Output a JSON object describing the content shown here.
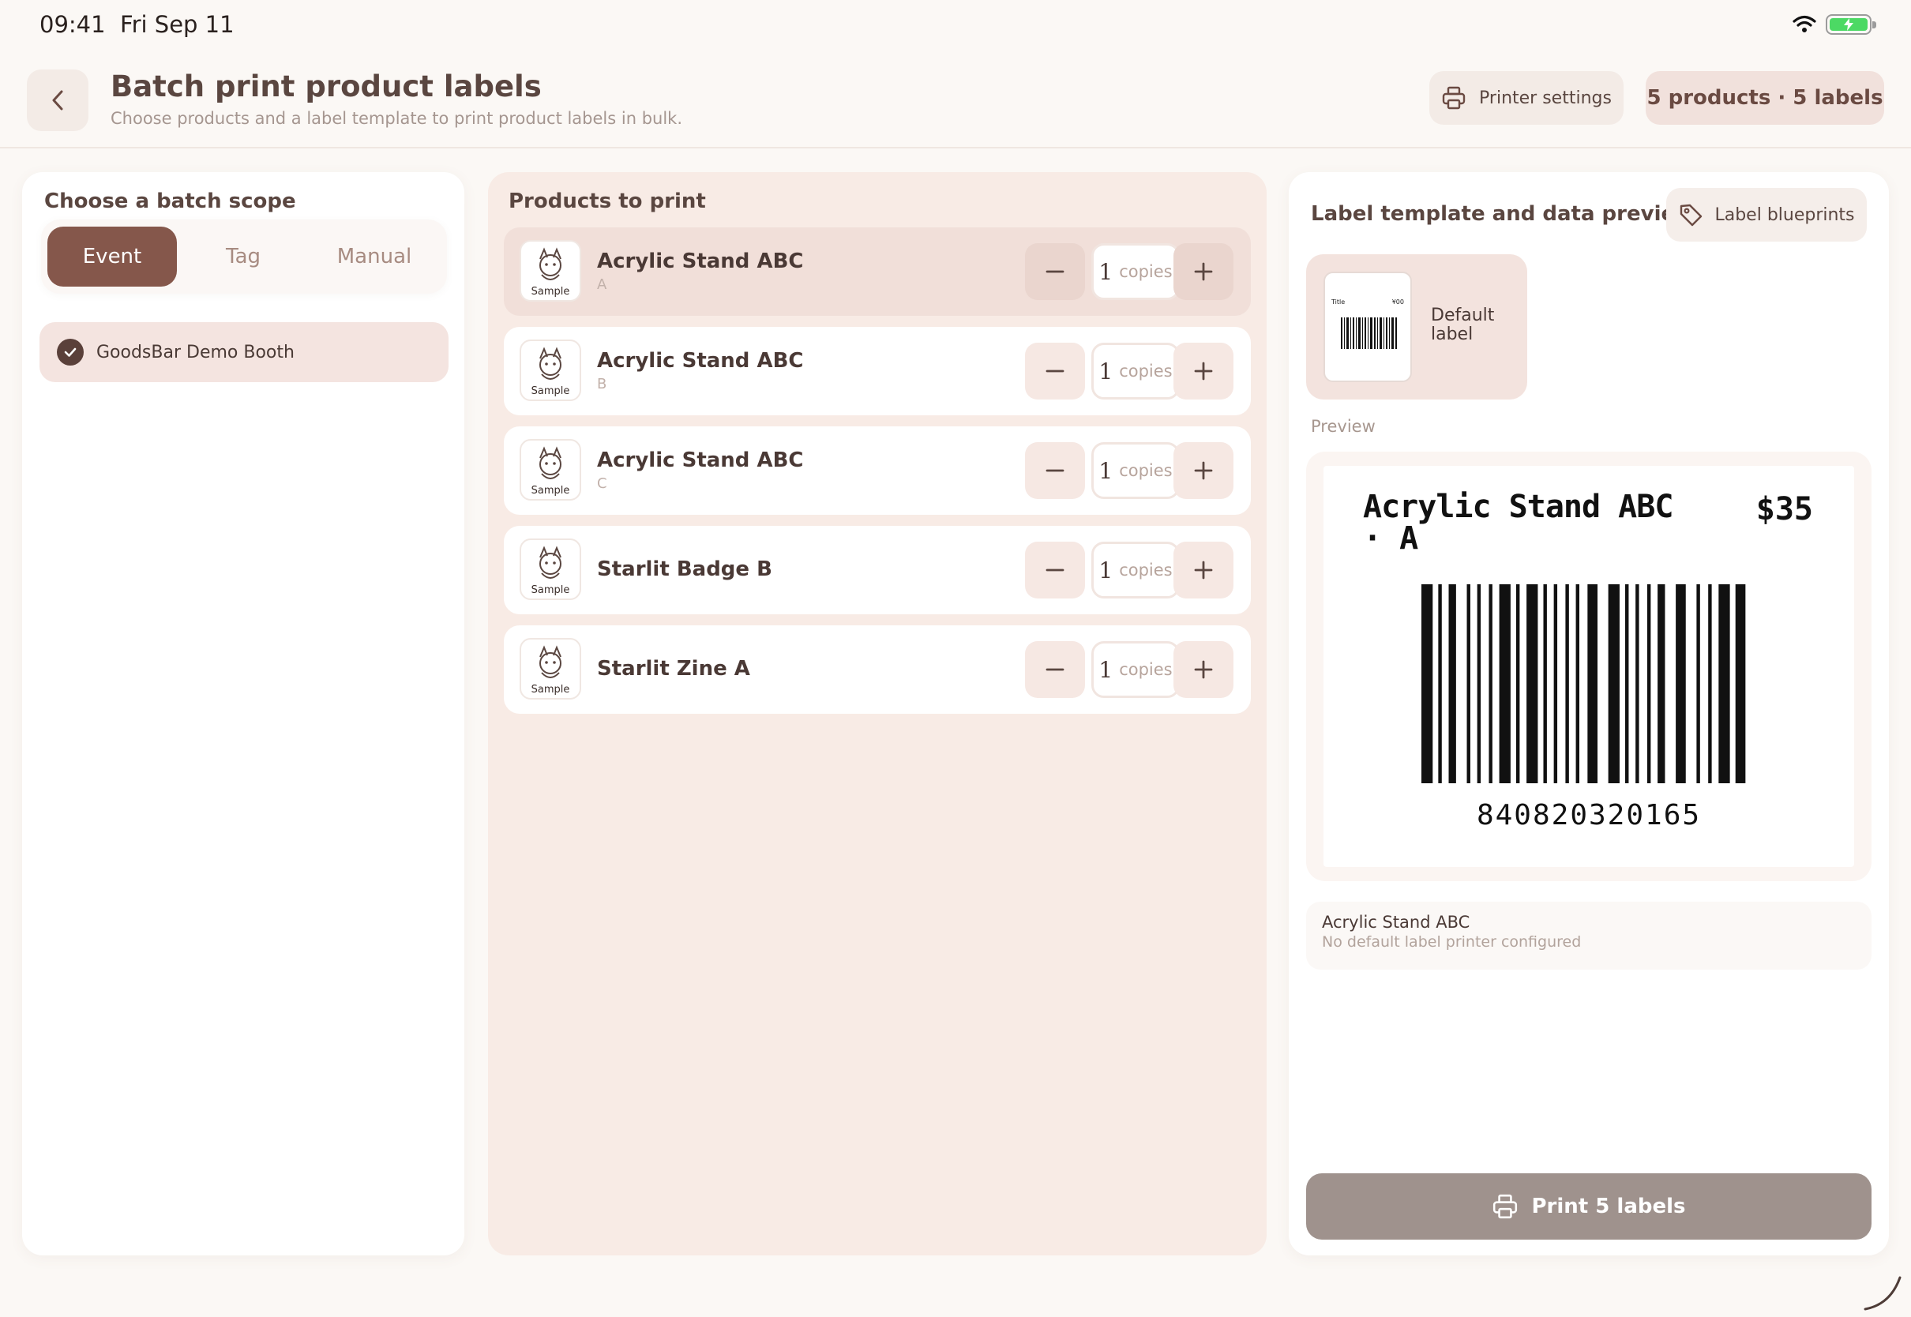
{
  "status_bar": {
    "time": "09:41",
    "date": "Fri Sep 11",
    "wifi_icon": "wifi-icon",
    "battery_icon": "battery-charging-icon"
  },
  "header": {
    "title": "Batch print product labels",
    "subtitle": "Choose products and a label template to print product labels in bulk.",
    "printer_settings_label": "Printer settings",
    "summary": "5 products · 5 labels"
  },
  "scope": {
    "title": "Choose a batch scope",
    "tabs": [
      {
        "label": "Event"
      },
      {
        "label": "Tag"
      },
      {
        "label": "Manual"
      }
    ],
    "selected_tab": "Event",
    "items": [
      {
        "label": "GoodsBar Demo Booth",
        "checked": true
      }
    ]
  },
  "products": {
    "title": "Products to print",
    "thumb_text": "Sample",
    "unit": "copies",
    "rows": [
      {
        "name": "Acrylic Stand ABC",
        "variant": "A",
        "qty": "1"
      },
      {
        "name": "Acrylic Stand ABC",
        "variant": "B",
        "qty": "1"
      },
      {
        "name": "Acrylic Stand ABC",
        "variant": "C",
        "qty": "1"
      },
      {
        "name": "Starlit Badge B",
        "variant": "",
        "qty": "1"
      },
      {
        "name": "Starlit Zine A",
        "variant": "",
        "qty": "1"
      }
    ]
  },
  "template": {
    "title": "Label template and data preview",
    "blueprints_label": "Label blueprints",
    "default_template_name": "Default label",
    "preview_caption": "Preview",
    "label": {
      "name": "Acrylic Stand ABC · A",
      "price": "$35",
      "barcode": "840820320165"
    },
    "info_name": "Acrylic Stand ABC",
    "info_status": "No default label printer configured",
    "print_label": "Print 5 labels"
  },
  "colors": {
    "accent": "#85574b",
    "print_button": "#9f928d",
    "selected_row": "#f1dfd9",
    "panel_mid": "#f8ebe5"
  }
}
